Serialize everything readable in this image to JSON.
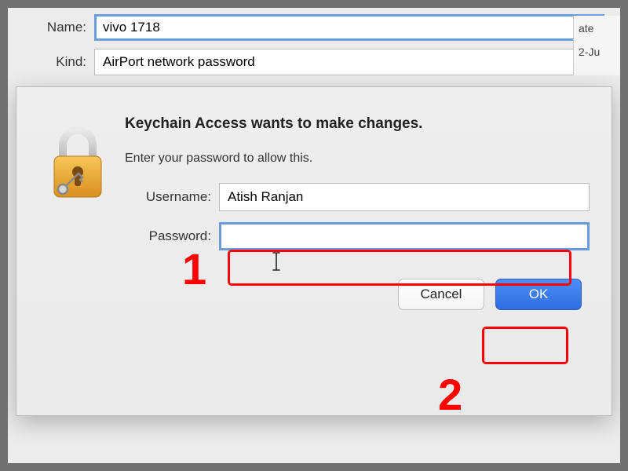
{
  "background": {
    "name_label": "Name:",
    "name_value": "vivo 1718",
    "kind_label": "Kind:",
    "kind_value": "AirPort network password",
    "right_items": [
      "ate",
      "2-Ju"
    ]
  },
  "modal": {
    "title": "Keychain Access wants to make changes.",
    "subtitle": "Enter your password to allow this.",
    "username_label": "Username:",
    "username_value": "Atish Ranjan",
    "password_label": "Password:",
    "password_value": "",
    "cancel_label": "Cancel",
    "ok_label": "OK"
  },
  "annotations": {
    "num1": "1",
    "num2": "2"
  }
}
